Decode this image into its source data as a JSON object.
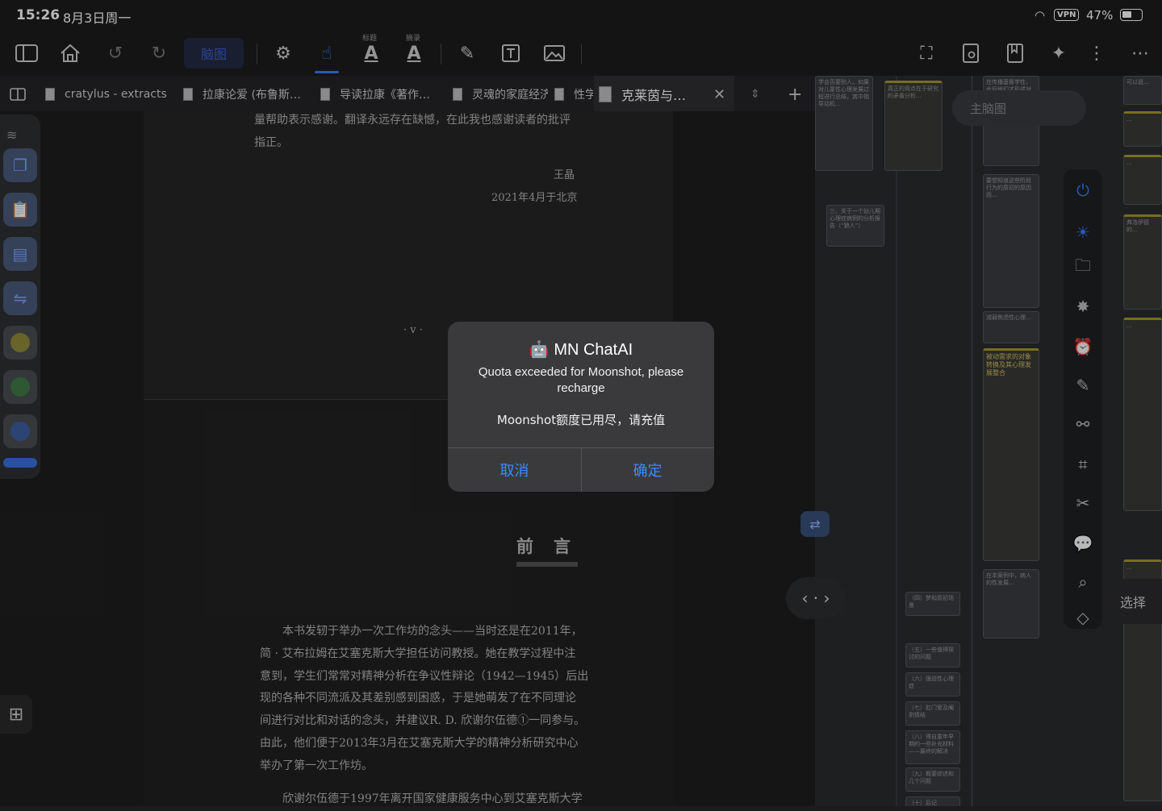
{
  "status": {
    "time": "15:26",
    "date": "8月3日周一",
    "vpn": "VPN",
    "battery": "47%"
  },
  "toolbar": {
    "brain_map": "脑图",
    "label_title": "标题",
    "label_excerpt": "摘录"
  },
  "tabs": [
    {
      "label": "cratylus - extracts"
    },
    {
      "label": "拉康论爱 (布鲁斯…"
    },
    {
      "label": "导读拉康《著作…"
    },
    {
      "label": "灵魂的家庭经济"
    },
    {
      "label": "性学"
    },
    {
      "label": "克莱茵与…"
    }
  ],
  "page": {
    "top_line1": "量帮助表示感谢。翻译永远存在缺憾，在此我也感谢读者的批评",
    "top_line2": "指正。",
    "sign_name": "王晶",
    "sign_date": "2021年4月于北京",
    "roman": "· v ·",
    "heading": "前　言",
    "paragraph": [
      "本书发轫于举办一次工作坊的念头——当时还是在2011年，",
      "简 · 艾布拉姆在艾塞克斯大学担任访问教授。她在教学过程中注",
      "意到，学生们常常对精神分析在争议性辩论（1942—1945）后出",
      "现的各种不同流派及其差别感到困惑，于是她萌发了在不同理论",
      "间进行对比和对话的念头，并建议R. D. 欣谢尔伍德①一同参与。",
      "由此，他们便于2013年3月在艾塞克斯大学的精神分析研究中心",
      "举办了第一次工作坊。"
    ],
    "last_line": "欣谢尔伍德于1997年离开国家健康服务中心到艾塞克斯大学"
  },
  "mindmap": {
    "main_label": "主脑图",
    "select_label": "选择",
    "nodes_left": [
      "三、关于一个幼儿期心理症病例的分析报告（“狼人”）",
      "（四）梦和原初场景",
      "（五）一些值得探讨的问题",
      "（六）强迫性心理症",
      "（七）肛门爱及阉割情结",
      "（八）得自童年早期的一些补充材料——最终的解决",
      "（九）概要综述和几个问题",
      "（十）后记"
    ],
    "nodes_center": [
      "被动需求的对象转换及其心理发展整合"
    ]
  },
  "dialog": {
    "icon": "🤖",
    "title": "MN ChatAI",
    "message": "Quota exceeded for Moonshot, please recharge",
    "message_cn": "Moonshot额度已用尽，请充值",
    "cancel": "取消",
    "confirm": "确定"
  },
  "colors": {
    "accent": "#3a8cff",
    "dialog_bg": "#3a3a3c",
    "brain_btn": "#3f5fd0"
  }
}
